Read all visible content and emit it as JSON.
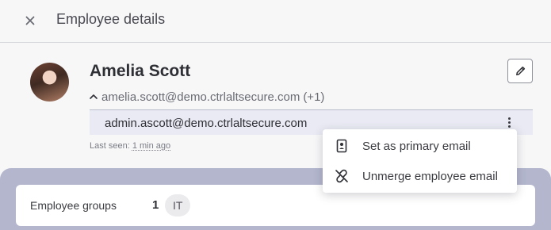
{
  "header": {
    "title": "Employee details"
  },
  "profile": {
    "name": "Amelia Scott",
    "primary_email": "amelia.scott@demo.ctrlaltsecure.com",
    "extra_count": "(+1)",
    "alternate_email": "admin.ascott@demo.ctrlaltsecure.com",
    "last_seen_label": "Last seen:",
    "last_seen_value": "1 min ago"
  },
  "groups": {
    "label": "Employee groups",
    "count": "1",
    "items": [
      "IT"
    ]
  },
  "menu": {
    "items": [
      {
        "label": "Set as primary email",
        "icon": "id-badge-icon"
      },
      {
        "label": "Unmerge employee email",
        "icon": "unlink-icon"
      }
    ]
  },
  "colors": {
    "background": "#f7f7f8",
    "alt_email_bg": "#e9eaf3",
    "lower_section": "#b3b6cd",
    "chip_bg": "#ebebee"
  }
}
